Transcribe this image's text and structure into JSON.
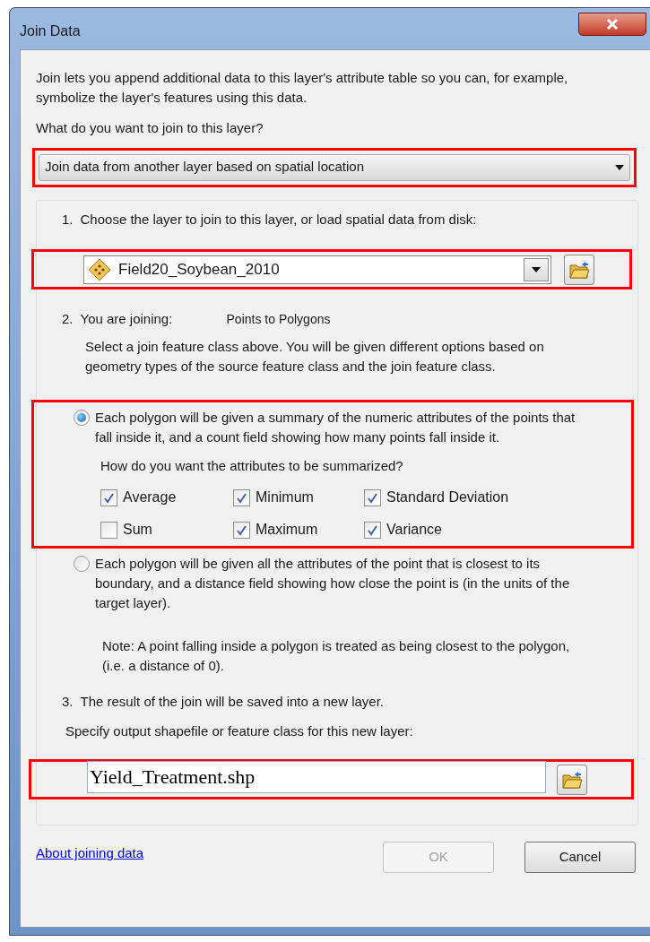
{
  "window": {
    "title": "Join Data"
  },
  "intro": "Join lets you append additional data to this layer's attribute table so you can, for example, symbolize the layer's features using this data.",
  "question": "What do you want to join to this layer?",
  "join_type": {
    "value": "Join data from another layer based on spatial location"
  },
  "step1": {
    "number": "1.",
    "label": "Choose the layer to join to this layer, or load spatial data from disk:",
    "layer": "Field20_Soybean_2010"
  },
  "step2": {
    "number": "2.",
    "label": "You are joining:",
    "value": "Points to Polygons",
    "description": "Select a join feature class above.  You will be given different options based on geometry types of the source feature class and the join feature class."
  },
  "options": [
    {
      "selected": true,
      "text": "Each polygon will be given a summary of the numeric attributes of the points that fall inside it, and a count field showing how many points fall inside it.",
      "summary_prompt": "How do you want the attributes to be summarized?",
      "statistics": [
        {
          "label": "Average",
          "checked": true
        },
        {
          "label": "Minimum",
          "checked": true
        },
        {
          "label": "Standard Deviation",
          "checked": true
        },
        {
          "label": "Sum",
          "checked": false
        },
        {
          "label": "Maximum",
          "checked": true
        },
        {
          "label": "Variance",
          "checked": true
        }
      ]
    },
    {
      "selected": false,
      "text": "Each polygon will be given all the attributes of the point that is closest to its boundary, and a distance field showing how close the point is (in the units of the target layer).",
      "note": "Note: A point falling inside a polygon is treated as being closest to the polygon, (i.e. a distance of 0)."
    }
  ],
  "step3": {
    "number": "3.",
    "label": "The result of the join will be saved into a new layer.",
    "prompt": "Specify output shapefile or feature class for this new layer:",
    "output": "Yield_Treatment.shp"
  },
  "link": "About joining data",
  "buttons": [
    {
      "label": "OK",
      "disabled": true
    },
    {
      "label": "Cancel",
      "disabled": false
    }
  ]
}
